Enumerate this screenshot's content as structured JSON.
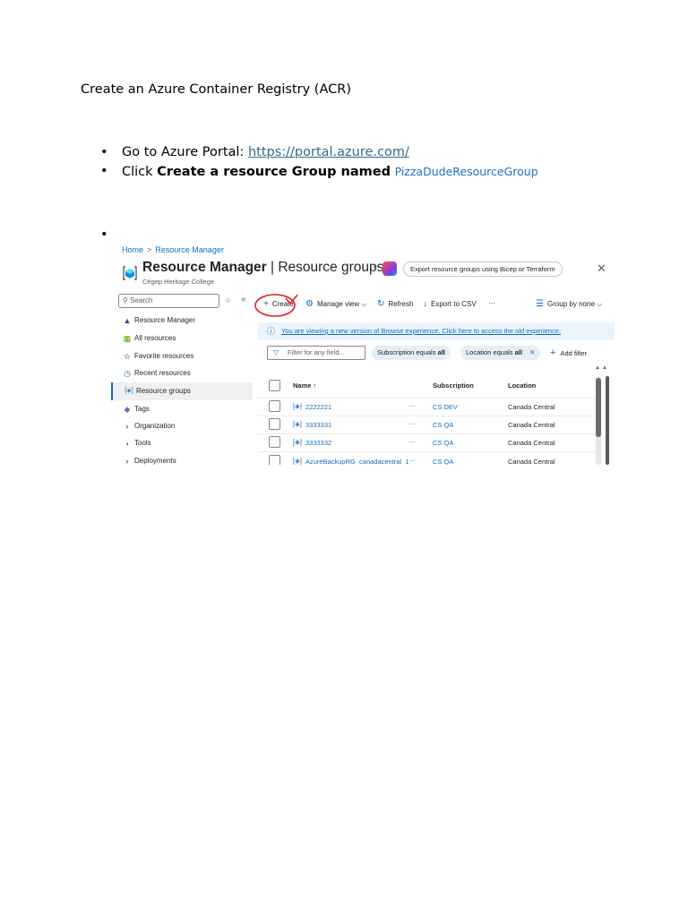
{
  "document": {
    "title": "Create an Azure Container Registry (ACR)",
    "bullet1_prefix": "Go to Azure Portal: ",
    "bullet1_link": "https://portal.azure.com/",
    "bullet2_prefix": "Click ",
    "bullet2_bold": "Create a resource Group named",
    "bullet2_name": "PizzaDudeResourceGroup"
  },
  "screenshot": {
    "breadcrumb": [
      "Home",
      "Resource Manager"
    ],
    "breadcrumb_sep": ">",
    "title_bold": "Resource Manager",
    "title_rest": " | Resource groups",
    "subtitle": "Cégep Heritage College",
    "more": "···",
    "export_bicep": "Export resource groups using Bicep or Terraform",
    "close": "✕",
    "search_placeholder": "Search",
    "collapse": "«",
    "nav": [
      {
        "icon": "resource-manager-icon",
        "label": "Resource Manager"
      },
      {
        "icon": "grid-icon",
        "label": "All resources"
      },
      {
        "icon": "star-icon",
        "label": "Favorite resources"
      },
      {
        "icon": "clock-icon",
        "label": "Recent resources"
      },
      {
        "icon": "resource-group-icon",
        "label": "Resource groups"
      },
      {
        "icon": "tag-icon",
        "label": "Tags"
      },
      {
        "icon": "chevron-right-icon",
        "label": "Organization"
      },
      {
        "icon": "chevron-right-icon",
        "label": "Tools"
      },
      {
        "icon": "chevron-right-icon",
        "label": "Deployments"
      }
    ],
    "toolbar": {
      "create": "Create",
      "manage_view": "Manage view",
      "refresh": "Refresh",
      "export_csv": "Export to CSV",
      "more": "···",
      "group_by": "Group by none"
    },
    "banner": "You are viewing a new version of Browse experience. Click here to access the old experience.",
    "filter_placeholder": "Filter for any field...",
    "pill1_prefix": "Subscription equals ",
    "pill1_bold": "all",
    "pill2_prefix": "Location equals ",
    "pill2_bold": "all",
    "pill_close": "✕",
    "add_filter": "Add filter",
    "columns": [
      "Name ↑",
      "Subscription",
      "Location"
    ],
    "rows": [
      {
        "name": "2222221",
        "dots": "···",
        "subscription": "CS DEV",
        "location": "Canada Central"
      },
      {
        "name": "3333331",
        "dots": "···",
        "subscription": "CS QA",
        "location": "Canada Central"
      },
      {
        "name": "3333332",
        "dots": "···",
        "subscription": "CS QA",
        "location": "Canada Central"
      },
      {
        "name": "AzureBackupRG_canadacentral_1",
        "dots": "···",
        "subscription": "CS QA",
        "location": "Canada Central"
      }
    ],
    "annotation_color": "#e02020",
    "accent": "#0f6cbd"
  }
}
